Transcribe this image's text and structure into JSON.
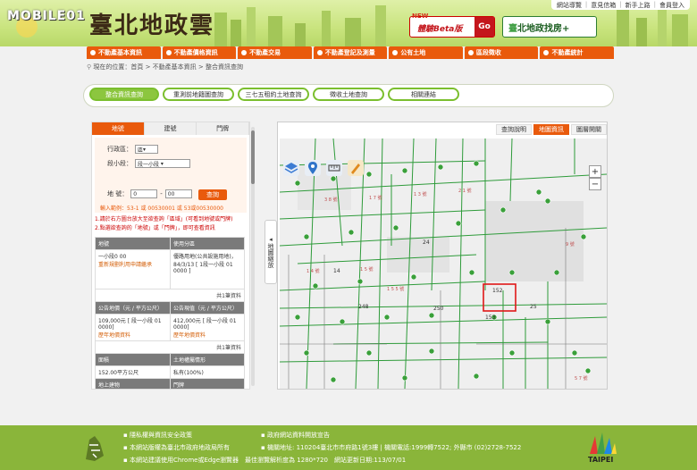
{
  "header": {
    "watermark": "MOBILE01",
    "logo": "臺北地政雲",
    "top_links": [
      "網站導覽",
      "意見信箱",
      "新手上路",
      "會員登入"
    ],
    "beta_new": "NEW",
    "beta_label": "體驗Beta版",
    "beta_go": "Go",
    "house_prefix": "臺",
    "house_label": "北地政找房+"
  },
  "nav": [
    "不動產基本資訊",
    "不動產價格資訊",
    "不動產交易",
    "不動產登記及測量",
    "公有土地",
    "區段徵收",
    "不動產統計"
  ],
  "breadcrumb": "現在的位置：首頁 > 不動產基本資訊 > 整合資訊查詢",
  "tabs": [
    "整合資訊查詢",
    "重測前地籍圖查詢",
    "三七五租約土地查詢",
    "徵收土地查詢",
    "相關連結"
  ],
  "panel": {
    "tabs": [
      "地號",
      "建號",
      "門牌"
    ],
    "district_label": "行政區：",
    "district_value": "區",
    "section_label": "段小段：",
    "section_value": "段一小段",
    "lot_label": "地  號：",
    "lot_main": "0",
    "lot_sub": "00",
    "query_button": "查詢",
    "hint": "輸入範例：53-1 或 00530001 或 53或00530000",
    "notes": [
      "1.請於右方圖台放大至欲查詢「區域」(可看到地號或門牌)",
      "2.點選欲查詢的「地號」或「門牌」，即可查看資訊"
    ],
    "table": {
      "h1": [
        "地號",
        "使用分區"
      ],
      "r1a": "一小段0         00",
      "r1a_link": "重新規劃利用申請繼承",
      "r1b": "優路用地(公共設施用地)，84/3/13 [ 1段一小段 01       0000 ]",
      "more1": "共1筆資料",
      "h2": [
        "公告地價（元 / 平方公尺）",
        "公告現值（元 / 平方公尺）"
      ],
      "r2a": "109,000元 [   段一小段 01      0000]",
      "r2b": "412,000元 [   段一小段 01      0000]",
      "r2_link_a": "歷年地價資料",
      "r2_link_b": "歷年地價資料",
      "more2": "共1筆資料",
      "h3": [
        "面積",
        "土地權屬情形"
      ],
      "r3a": "152.00平方公尺",
      "r3b": "私有(100%)",
      "h4": [
        "地上建物",
        "門牌"
      ]
    }
  },
  "map": {
    "handle_label": "地圖縮放",
    "bar": [
      "查詢說明",
      "地圖資訊",
      "圖層開關"
    ],
    "zoom_in": "+",
    "zoom_out": "−",
    "lot_labels": [
      "152",
      "153",
      "250",
      "248",
      "24",
      "25",
      "14"
    ]
  },
  "footer": {
    "privacy": "隱私權與資訊安全政策",
    "copyright": "本網站版權為臺北市政府地政局所有",
    "browser": "本網站建議使用Chrome或Edge瀏覽器　最佳瀏覽解析度為 1280*720　網站更新日期:113/07/01",
    "open": "政府網站資料開放宣告",
    "address": "機關地址: 110204臺北市市府路1號3樓 | 機關電話:1999轉7522; 外縣市 (02)2728-7522",
    "taipei": "TAIPEI"
  }
}
